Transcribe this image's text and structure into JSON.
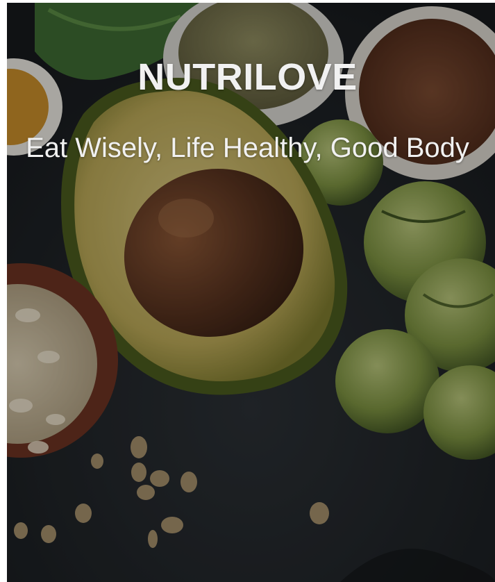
{
  "hero": {
    "title": "NUTRILOVE",
    "tagline": "Eat Wisely, Life Healthy, Good Body",
    "background_image": "avocado-sprouts-oats-photo"
  },
  "colors": {
    "text": "#f1f1f1",
    "board": "#1f2327",
    "avocado_flesh": "#a79b4a",
    "avocado_pit": "#5a3420",
    "sprouts": "#768b3d",
    "bowl_clay": "#6b3322"
  }
}
